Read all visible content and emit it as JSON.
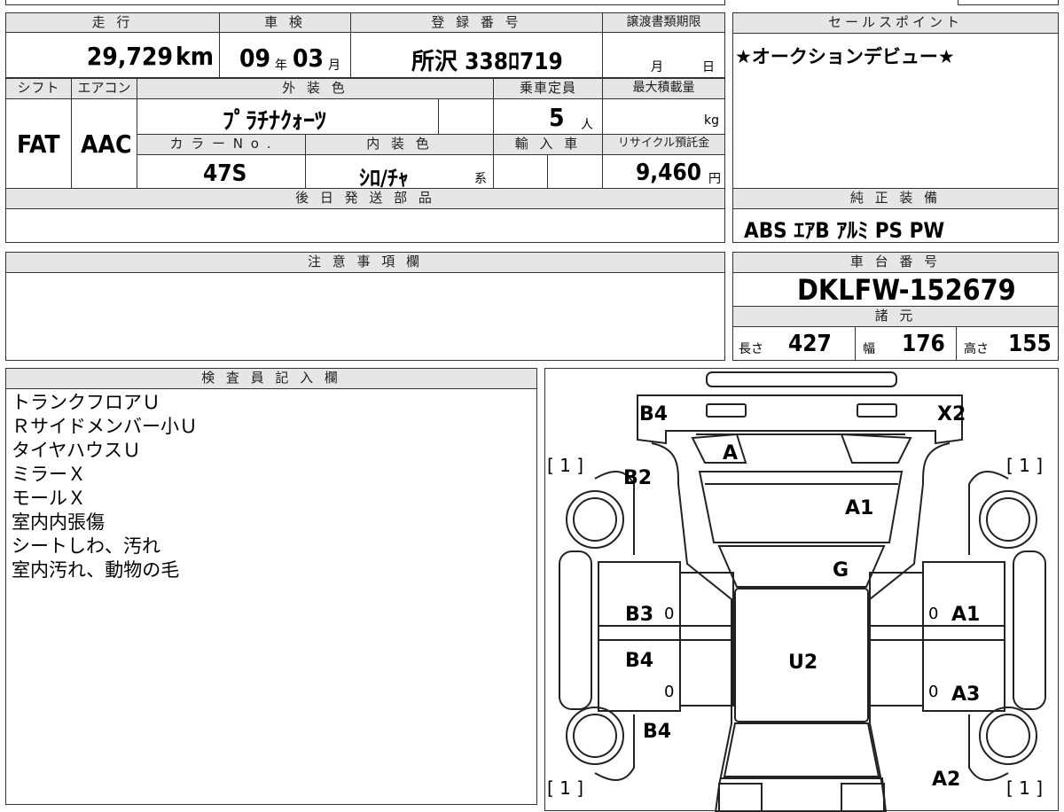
{
  "header": {
    "mileage_label": "走 行",
    "inspection_label": "車 検",
    "registration_label": "登 録 番 号",
    "transfer_docs_label": "譲渡書類期限",
    "mileage_value": "29,729",
    "mileage_unit": "km",
    "inspection_year": "09",
    "year_unit": "年",
    "inspection_month": "03",
    "month_unit": "月",
    "registration_number": "所沢 338ﾛ719",
    "transfer_month_unit": "月",
    "transfer_day_unit": "日"
  },
  "sales_points": {
    "label": "セールスポイント",
    "text": "★オークションデビュー★"
  },
  "specs": {
    "shift_label": "シフト",
    "aircon_label": "エアコン",
    "exterior_color_label": "外 装 色",
    "capacity_label": "乗車定員",
    "max_load_label": "最大積載量",
    "shift_value": "FAT",
    "aircon_value": "AAC",
    "exterior_color_value": "ﾌﾟﾗﾁﾅｸｫｰﾂ",
    "capacity_value": "5",
    "capacity_unit": "人",
    "max_load_unit": "kg",
    "color_no_label": "カ ラ ー N o .",
    "interior_color_label": "内 装 色",
    "import_label": "輸 入 車",
    "recycle_label": "リサイクル預託金",
    "color_no_value": "47S",
    "interior_color_value": "ｼﾛ/ﾁｬ",
    "interior_suffix": "系",
    "recycle_value": "9,460",
    "recycle_unit": "円"
  },
  "later_parts": {
    "label": "後 日 発 送 部 品"
  },
  "genuine_equipment": {
    "label": "純 正 装 備",
    "items": "ABS ｴｱB ｱﾙﾐ PS PW"
  },
  "notes": {
    "label": "注 意 事 項 欄"
  },
  "chassis": {
    "label": "車 台 番 号",
    "number": "DKLFW-152679",
    "specs_label": "諸 元",
    "length_label": "長さ",
    "length_value": "427",
    "width_label": "幅",
    "width_value": "176",
    "height_label": "高さ",
    "height_value": "155"
  },
  "inspector": {
    "label": "検 査 員 記 入 欄",
    "lines": [
      "トランクフロアＵ",
      "Ｒサイドメンバー小Ｕ",
      "タイヤハウスＵ",
      "ミラーＸ",
      "モールＸ",
      "室内内張傷",
      "シートしわ、汚れ",
      "室内汚れ、動物の毛"
    ]
  },
  "diagram": {
    "marks": {
      "rear_left": "B4",
      "rear_right": "X2",
      "rear_glass": "A",
      "rear_left_quarter": "B2",
      "trunk": "A1",
      "roof_rear": "G",
      "left_rear_door": "B3",
      "right_rear_door": "A1",
      "left_front_door": "B4",
      "roof": "U2",
      "right_front_door": "A3",
      "left_front_fender": "B4",
      "right_front_fender": "A2"
    },
    "tire_tl": "[ 1 ]",
    "tire_tr": "[ 1 ]",
    "tire_bl": "[ 1 ]",
    "tire_br": "[ 1 ]",
    "zero": "0"
  }
}
